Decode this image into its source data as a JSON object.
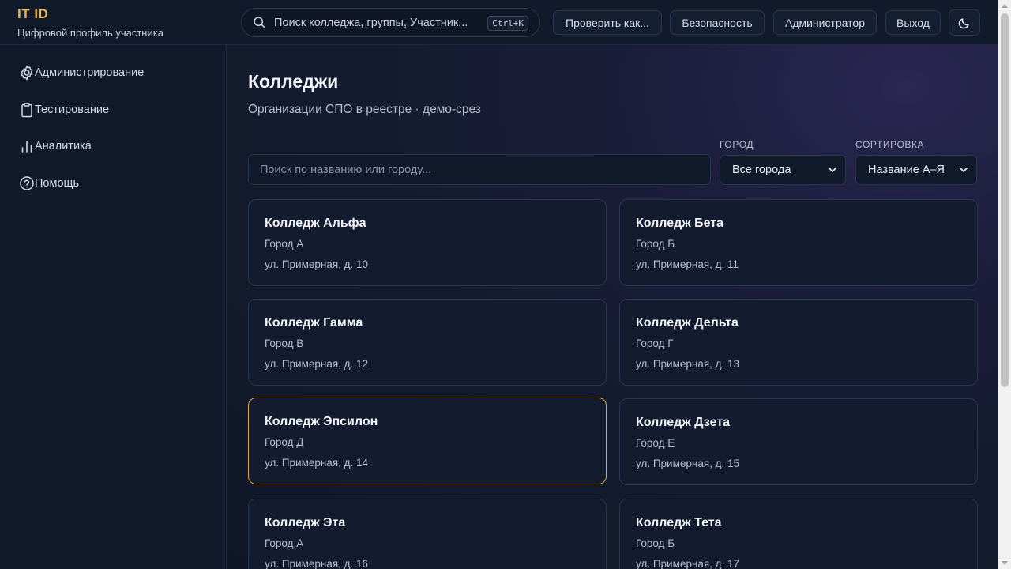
{
  "brand": {
    "title": "IT ID",
    "subtitle": "Цифровой профиль участника"
  },
  "header": {
    "search_text": "Поиск колледжа, группы, Участник...",
    "search_shortcut": "Ctrl+K",
    "buttons": {
      "check_as": "Проверить как...",
      "security": "Безопасность",
      "admin": "Администратор",
      "logout": "Выход"
    },
    "theme_icon": "moon-icon"
  },
  "sidebar": {
    "items": [
      {
        "label": "Администрирование",
        "icon": "gear-icon"
      },
      {
        "label": "Тестирование",
        "icon": "clipboard-icon"
      },
      {
        "label": "Аналитика",
        "icon": "bar-chart-icon"
      },
      {
        "label": "Помощь",
        "icon": "help-circle-icon"
      }
    ]
  },
  "main": {
    "title": "Колледжи",
    "subtitle": "Организации СПО в реестре · демо-срез",
    "filter": {
      "placeholder": "Поиск по названию или городу...",
      "city_label": "ГОРОД",
      "city_value": "Все города",
      "sort_label": "СОРТИРОВКА",
      "sort_value": "Название А–Я"
    },
    "colleges": [
      {
        "name": "Колледж Альфа",
        "city": "Город А",
        "address": "ул. Примерная, д. 10"
      },
      {
        "name": "Колледж Бета",
        "city": "Город Б",
        "address": "ул. Примерная, д. 11"
      },
      {
        "name": "Колледж Гамма",
        "city": "Город В",
        "address": "ул. Примерная, д. 12"
      },
      {
        "name": "Колледж Дельта",
        "city": "Город Г",
        "address": "ул. Примерная, д. 13"
      },
      {
        "name": "Колледж Эпсилон",
        "city": "Город Д",
        "address": "ул. Примерная, д. 14"
      },
      {
        "name": "Колледж Дзета",
        "city": "Город Е",
        "address": "ул. Примерная, д. 15"
      },
      {
        "name": "Колледж Эта",
        "city": "Город А",
        "address": "ул. Примерная, д. 16"
      },
      {
        "name": "Колледж Тета",
        "city": "Город Б",
        "address": "ул. Примерная, д. 17"
      }
    ]
  },
  "colors": {
    "accent": "#f0b64a",
    "background": "#0f1727",
    "selected_border": "#e0a93a"
  }
}
